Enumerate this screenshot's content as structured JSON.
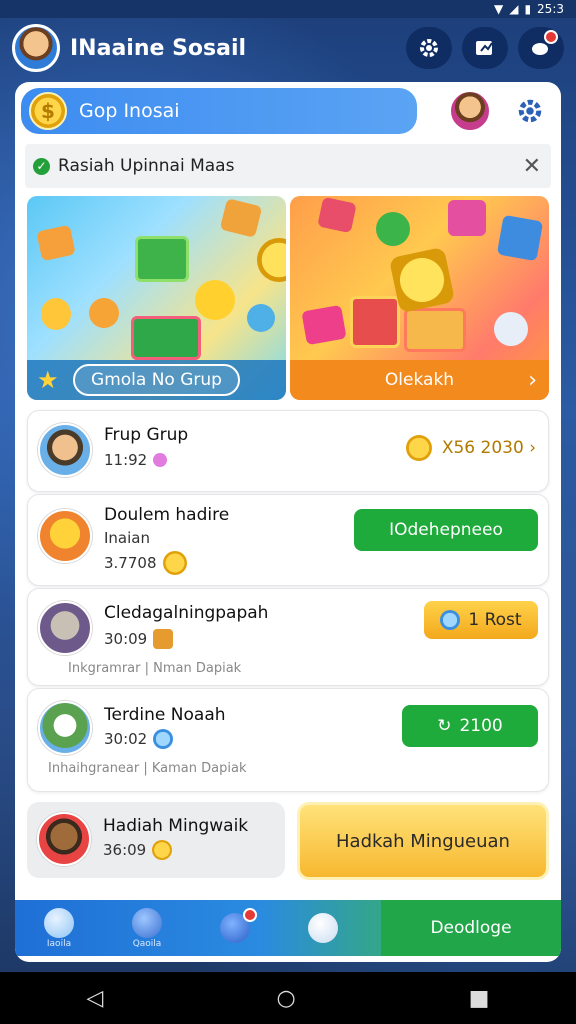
{
  "status_bar": {
    "time": "25:3"
  },
  "header": {
    "title": "INaaine Sosail"
  },
  "panel": {
    "title": "Gop Inosai",
    "notice": "Rasiah Upinnai Maas"
  },
  "banners": {
    "left_button": "Gmola No Grup",
    "right_label": "Olekakh"
  },
  "rows": [
    {
      "name": "Frup Grup",
      "sub": "11:92",
      "counter": "X56 2030 ›"
    },
    {
      "name": "Doulem hadire",
      "sub2": "Inaian",
      "sub": "3.7708",
      "action": "IOdehepneeo"
    },
    {
      "name": "Cledagalningpapah",
      "sub": "30:09",
      "footer": "Inkgramrar | Nman Dapiak",
      "action": "1 Rost"
    },
    {
      "name": "Terdine Noaah",
      "sub": "30:02",
      "footer": "Inhaihgranear | Kaman Dapiak",
      "action": "2100"
    }
  ],
  "bottom": {
    "weekly_name": "Hadiah Mingwaik",
    "weekly_sub": "36:09",
    "weekly_button": "Hadkah Mingueuan"
  },
  "nav": {
    "items": [
      "Iaoila",
      "Qaoila",
      "",
      ""
    ],
    "cta": "Deodloge"
  },
  "colors": {
    "accent_blue": "#3d8cf0",
    "accent_green": "#1faa3c",
    "accent_yellow": "#f7b82f"
  }
}
